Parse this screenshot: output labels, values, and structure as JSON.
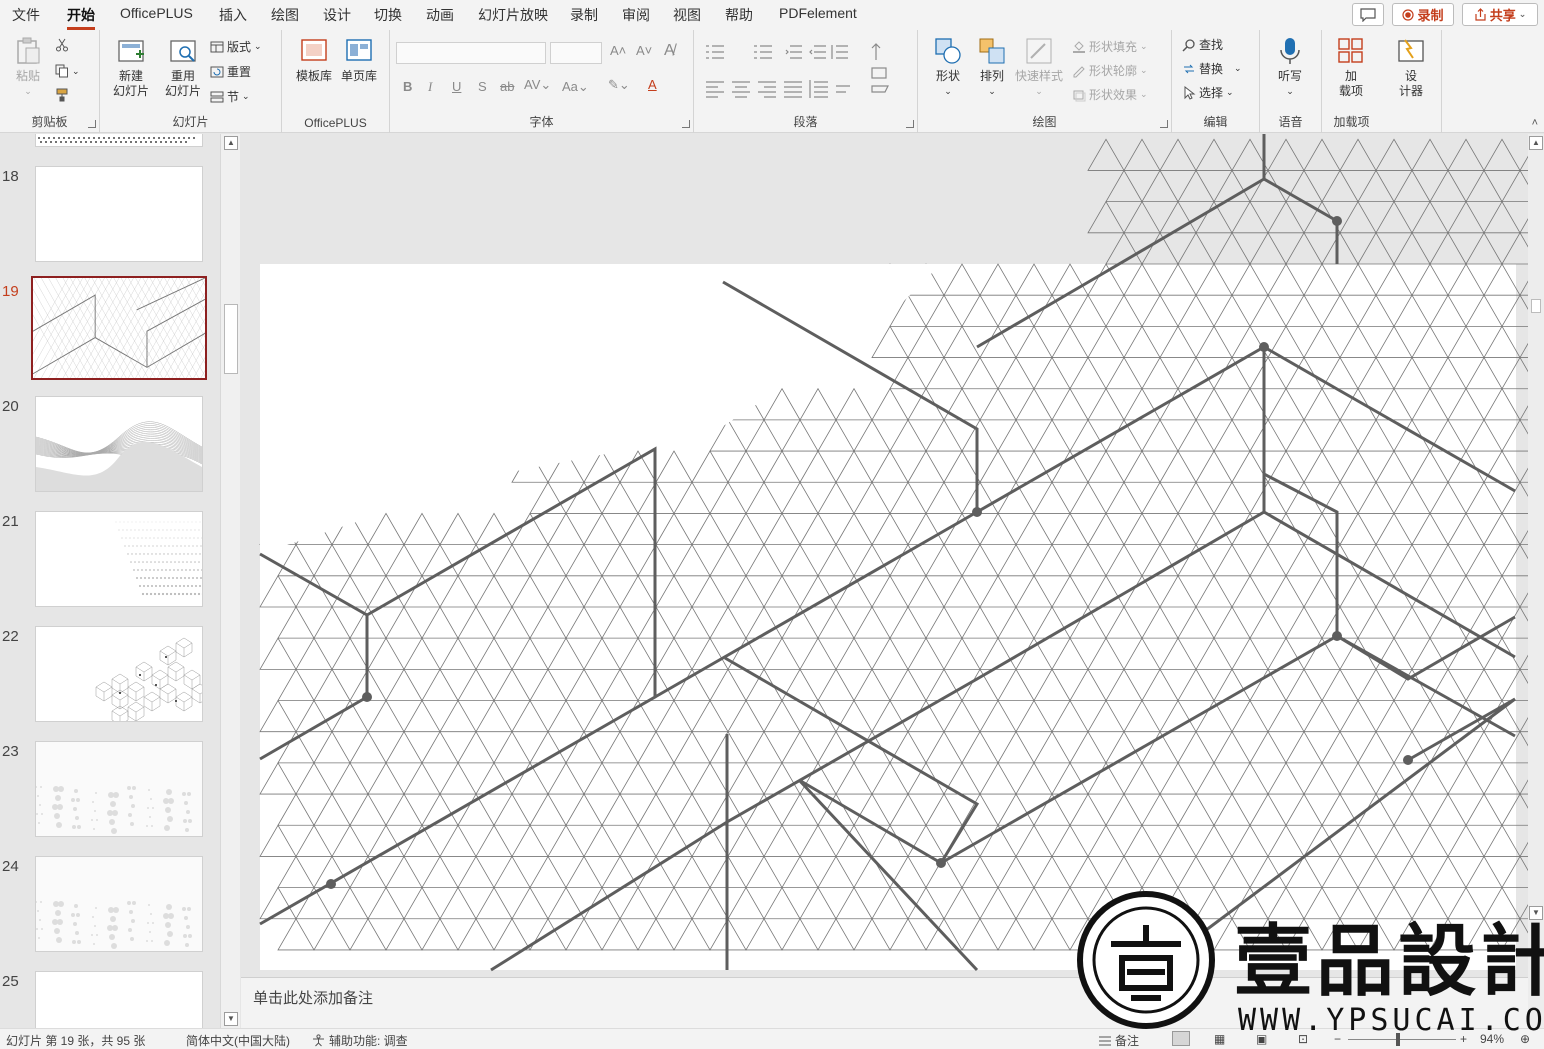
{
  "menu": {
    "tabs": [
      "文件",
      "开始",
      "OfficePLUS",
      "插入",
      "绘图",
      "设计",
      "切换",
      "动画",
      "幻灯片放映",
      "录制",
      "审阅",
      "视图",
      "帮助",
      "PDFelement"
    ],
    "active_tab": "开始",
    "record_label": "录制",
    "share_label": "共享"
  },
  "ribbon": {
    "clipboard": {
      "label": "剪贴板",
      "paste": "粘贴"
    },
    "slides": {
      "label": "幻灯片",
      "new_slide": "新建\n幻灯片",
      "reuse_slide": "重用\n幻灯片",
      "layout": "版式",
      "reset": "重置",
      "section": "节"
    },
    "officeplus": {
      "label": "OfficePLUS",
      "template": "模板库",
      "single_page": "单页库"
    },
    "font": {
      "label": "字体"
    },
    "paragraph": {
      "label": "段落"
    },
    "drawing": {
      "label": "绘图",
      "shapes": "形状",
      "arrange": "排列",
      "quick_styles": "快速样式",
      "fill": "形状填充",
      "outline": "形状轮廓",
      "effects": "形状效果"
    },
    "editing": {
      "label": "编辑",
      "find": "查找",
      "replace": "替换",
      "select": "选择"
    },
    "voice": {
      "label": "语音",
      "dictate": "听写"
    },
    "addins": {
      "label": "加载项",
      "addins": "加\n载项",
      "designer": "设\n计器"
    }
  },
  "thumbnails": [
    {
      "num": "18",
      "style": "blank"
    },
    {
      "num": "19",
      "style": "hexgrid",
      "selected": true
    },
    {
      "num": "20",
      "style": "waves"
    },
    {
      "num": "21",
      "style": "dots"
    },
    {
      "num": "22",
      "style": "cubes"
    },
    {
      "num": "23",
      "style": "terrain"
    },
    {
      "num": "24",
      "style": "terrain"
    },
    {
      "num": "25",
      "style": "blank"
    }
  ],
  "notes": {
    "placeholder": "单击此处添加备注"
  },
  "status": {
    "slide_info": "幻灯片 第 19 张，共 95 张",
    "language": "简体中文(中国大陆)",
    "accessibility": "辅助功能: 调查",
    "notes_button": "备注",
    "zoom": "94%"
  },
  "watermark": {
    "text": "壹品設計",
    "url": "WWW.YPSUCAI.COM"
  },
  "colors": {
    "accent": "#c43e1c",
    "selection": "#8e2020",
    "line": "#5e5e5e",
    "thin_line": "#777777"
  }
}
